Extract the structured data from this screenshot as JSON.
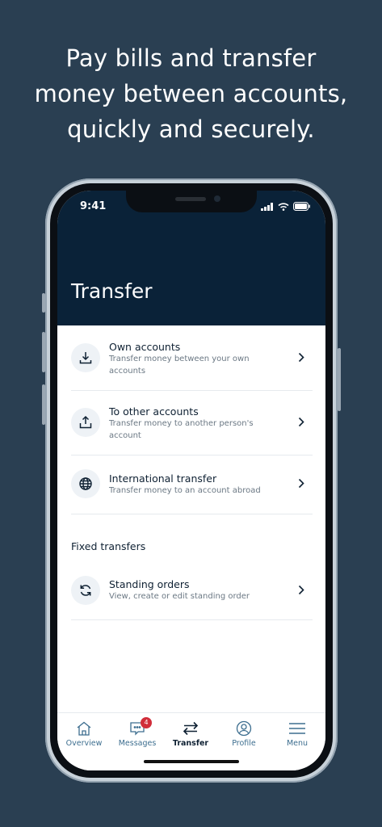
{
  "headline": {
    "line1": "Pay bills and transfer",
    "line2": "money between accounts,",
    "line3": "quickly and securely."
  },
  "status_bar": {
    "time": "9:41"
  },
  "page": {
    "title": "Transfer"
  },
  "transfer_options": [
    {
      "title": "Own accounts",
      "subtitle": "Transfer money between your own accounts",
      "icon": "download-icon"
    },
    {
      "title": "To other accounts",
      "subtitle": "Transfer money to another person's account",
      "icon": "upload-icon"
    },
    {
      "title": "International transfer",
      "subtitle": "Transfer money to an account abroad",
      "icon": "globe-icon"
    }
  ],
  "fixed_transfers": {
    "heading": "Fixed transfers",
    "items": [
      {
        "title": "Standing orders",
        "subtitle": "View, create or edit standing order",
        "icon": "refresh-icon"
      }
    ]
  },
  "tabbar": {
    "tabs": [
      {
        "label": "Overview",
        "icon": "home-icon"
      },
      {
        "label": "Messages",
        "icon": "message-icon",
        "badge": "4"
      },
      {
        "label": "Transfer",
        "icon": "transfer-arrows-icon",
        "active": true
      },
      {
        "label": "Profile",
        "icon": "profile-icon"
      },
      {
        "label": "Menu",
        "icon": "hamburger-icon"
      }
    ]
  },
  "colors": {
    "background": "#2a3f52",
    "header": "#0a2238",
    "accent": "#3d6e8f",
    "badge": "#d12d3a"
  }
}
